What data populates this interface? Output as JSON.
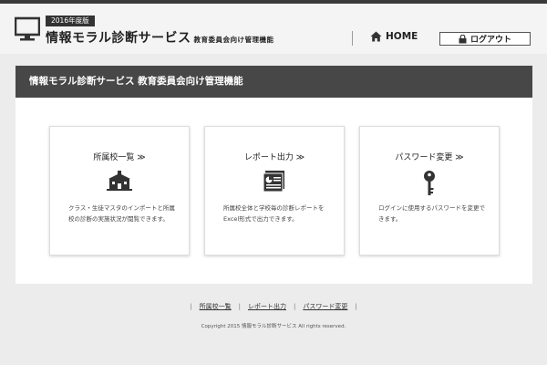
{
  "header": {
    "year_badge": "2016年度版",
    "brand": "情報モラル診断サービス",
    "brand_sub": "教育委員会向け管理機能",
    "home_label": "HOME",
    "logout_label": "ログアウト",
    "home_icon": "house-icon",
    "logout_icon": "lock-icon"
  },
  "panel": {
    "title": "情報モラル診断サービス 教育委員会向け管理機能"
  },
  "cards": [
    {
      "title": "所属校一覧",
      "chevron": "≫",
      "icon": "school-icon",
      "desc": "クラス・生徒マスタのインポートと所属校の診断の実施状況が閲覧できます。"
    },
    {
      "title": "レポート出力",
      "chevron": "≫",
      "icon": "report-icon",
      "desc": "所属校全体と学校毎の診断レポートをExcel形式で出力できます。"
    },
    {
      "title": "パスワード変更",
      "chevron": "≫",
      "icon": "key-icon",
      "desc": "ログインに使用するパスワードを変更できます。"
    }
  ],
  "footer": {
    "links": [
      "所属校一覧",
      "レポート出力",
      "パスワード変更"
    ],
    "separator": "|",
    "copyright": "Copyright 2015 情報モラル診断サービス All rights reserved."
  },
  "colors": {
    "topbar": "#3a3a3a",
    "panel_header": "#474747",
    "background": "#ececec",
    "header_bg": "#f4f4f4"
  }
}
